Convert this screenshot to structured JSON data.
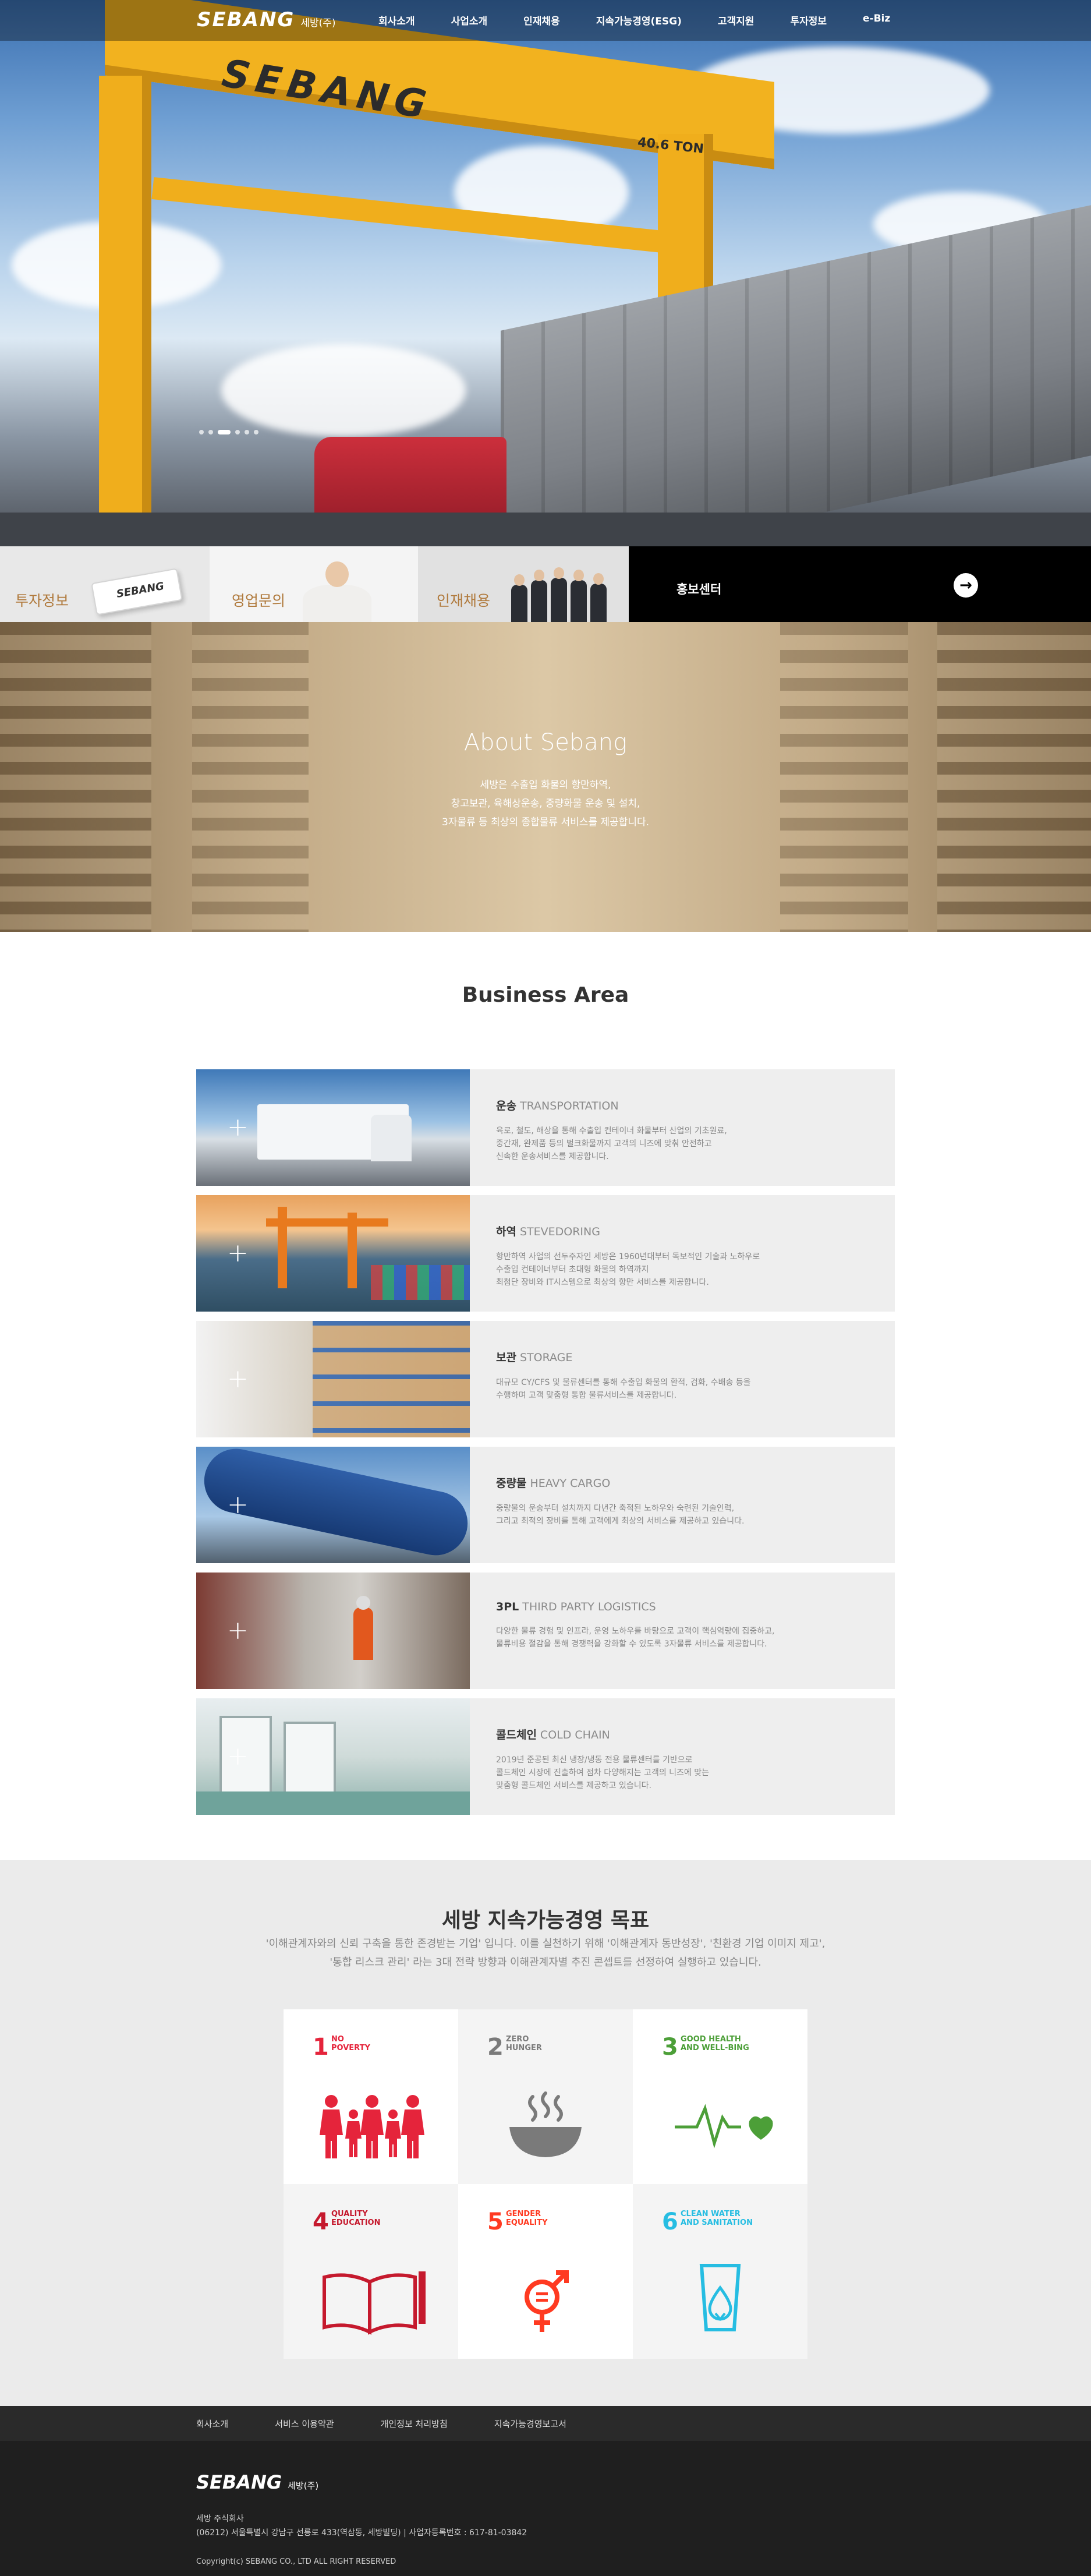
{
  "header": {
    "logo_mark": "SEBANG",
    "logo_sub": "세방(주)",
    "nav": [
      "회사소개",
      "사업소개",
      "인재채용",
      "지속가능경영(ESG)",
      "고객지원",
      "투자정보",
      "e-Biz"
    ]
  },
  "hero": {
    "crane_brand": "SEBANG",
    "crane_tonnage": "40.6 TON",
    "slide_count": 6,
    "active_slide": 3
  },
  "quick": {
    "ir_label": "투자정보",
    "card_text": "SEBANG",
    "sales_label": "영업문의",
    "recruit_label": "인재채용",
    "pr_label": "홍보센터"
  },
  "about": {
    "title": "About Sebang",
    "lines": [
      "세방은 수출입 화물의 항만하역,",
      "창고보관, 육해상운송, 중량화물 운송 및 설치,",
      "3자물류 등 최상의 종합물류 서비스를 제공합니다."
    ]
  },
  "business": {
    "title": "Business Area",
    "items": [
      {
        "ko": "운송",
        "en": "TRANSPORTATION",
        "desc": "육로, 철도, 해상을 통해 수출입 컨테이너 화물부터 산업의 기초원료,\n중간재, 완제품 등의 벌크화물까지 고객의 니즈에 맞춰 안전하고\n신속한 운송서비스를 제공합니다.",
        "icon": "truck-image"
      },
      {
        "ko": "하역",
        "en": "STEVEDORING",
        "desc": "항만하역 사업의 선두주자인 세방은 1960년대부터 독보적인 기술과 노하우로\n수출입 컨테이너부터 초대형 화물의 하역까지\n최첨단 장비와 IT시스템으로 최상의 항만 서비스를 제공합니다.",
        "icon": "port-crane-image"
      },
      {
        "ko": "보관",
        "en": "STORAGE",
        "desc": "대규모 CY/CFS 및 물류센터를 통해 수출입 화물의 환적, 검화, 수배송 등을\n수행하며 고객 맞춤형 통합 물류서비스를 제공합니다.",
        "icon": "warehouse-image"
      },
      {
        "ko": "중량물",
        "en": "HEAVY CARGO",
        "desc": "중량물의 운송부터 설치까지 다년간 축적된 노하우와 숙련된 기술인력,\n그리고 최적의 장비를 통해 고객에게 최상의 서비스를 제공하고 있습니다.",
        "icon": "heavy-cargo-image"
      },
      {
        "ko": "3PL",
        "en": "THIRD PARTY LOGISTICS",
        "desc": "다양한 물류 경험 및 인프라, 운영 노하우를 바탕으로 고객이 핵심역량에 집중하고,\n물류비용 절감을 통해 경쟁력을 강화할 수 있도록 3자물류 서비스를 제공합니다.",
        "icon": "logistics-worker-image"
      },
      {
        "ko": "콜드체인",
        "en": "COLD CHAIN",
        "desc": "2019년 준공된 최신 냉장/냉동 전용 물류센터를 기반으로\n콜드체인 시장에 진출하여 점차 다양해지는 고객의 니즈에 맞는\n맞춤형 콜드체인 서비스를 제공하고 있습니다.",
        "icon": "cold-storage-image"
      }
    ]
  },
  "esg": {
    "title": "세방 지속가능경영 목표",
    "intro": "'이해관계자와의 신뢰 구축을 통한 존경받는 기업' 입니다. 이를 실천하기 위해 '이해관계자 동반성장', '친환경 기업 이미지 제고',\n'통합 리스크 관리' 라는 3대 전략 방향과 이해관계자별 추진 콘셉트를 선정하여 실행하고 있습니다.",
    "goals": [
      {
        "num": "1",
        "name": "NO\nPOVERTY",
        "color": "#e5243b",
        "icon": "family-icon"
      },
      {
        "num": "2",
        "name": "ZERO\nHUNGER",
        "color": "#7a7a7a",
        "icon": "bowl-icon"
      },
      {
        "num": "3",
        "name": "GOOD HEALTH\nAND WELL-BING",
        "color": "#4c9f38",
        "icon": "heartbeat-icon"
      },
      {
        "num": "4",
        "name": "QUALITY\nEDUCATION",
        "color": "#c5192d",
        "icon": "book-icon"
      },
      {
        "num": "5",
        "name": "GENDER\nEQUALITY",
        "color": "#ff3a21",
        "icon": "gender-icon"
      },
      {
        "num": "6",
        "name": "CLEAN WATER\nAND SANITATION",
        "color": "#26bde2",
        "icon": "water-glass-icon"
      }
    ]
  },
  "footer": {
    "links": [
      "회사소개",
      "서비스 이용약관",
      "개인정보 처리방침",
      "지속가능경영보고서"
    ],
    "logo_mark": "SEBANG",
    "logo_sub": "세방(주)",
    "company": "세방 주식회사",
    "address": "(06212) 서울특별시 강남구 선릉로 433(역삼동, 세방빌딩) | 사업자등록번호 : 617-81-03842",
    "copyright": "Copyright(c) SEBANG CO., LTD ALL RIGHT RESERVED"
  }
}
